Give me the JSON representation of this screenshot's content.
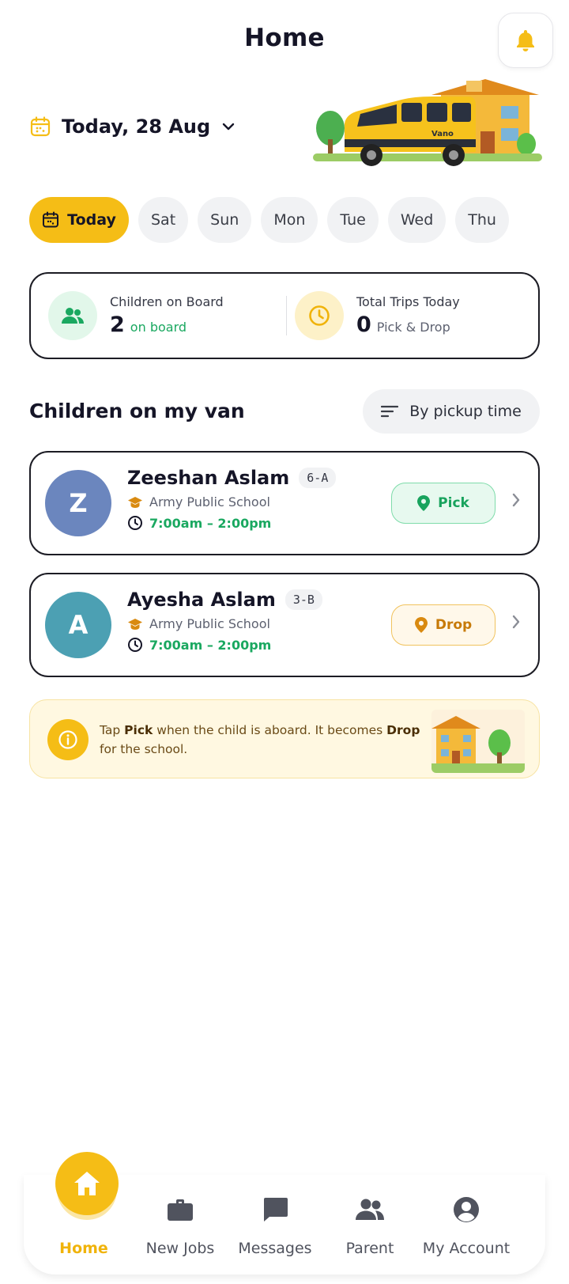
{
  "header": {
    "title": "Home"
  },
  "date": {
    "label": "Today, 28 Aug"
  },
  "days": [
    "Today",
    "Sat",
    "Sun",
    "Mon",
    "Tue",
    "Wed",
    "Thu"
  ],
  "stats": {
    "children": {
      "label": "Children on Board",
      "value": "2",
      "unit": "on board"
    },
    "trips": {
      "label": "Total Trips Today",
      "value": "0",
      "unit": "Pick & Drop"
    }
  },
  "section": {
    "title": "Children on my van",
    "sort_label": "By pickup time"
  },
  "children": [
    {
      "initial": "Z",
      "name": "Zeeshan Aslam",
      "class": "6-A",
      "school": "Army Public School",
      "time": "7:00am – 2:00pm",
      "action": "Pick",
      "avatar_color": "#6b86be"
    },
    {
      "initial": "A",
      "name": "Ayesha Aslam",
      "class": "3-B",
      "school": "Army Public School",
      "time": "7:00am – 2:00pm",
      "action": "Drop",
      "avatar_color": "#4ca0b3"
    }
  ],
  "tip": {
    "part1": "Tap ",
    "pick": "Pick",
    "part2": " when the child is aboard. It becomes ",
    "drop": "Drop",
    "part3": " for the school."
  },
  "nav": [
    "Home",
    "New Jobs",
    "Messages",
    "Parent",
    "My Account"
  ],
  "colors": {
    "accent": "#f5bd16",
    "green": "#1aa860",
    "orange": "#c77a08"
  }
}
